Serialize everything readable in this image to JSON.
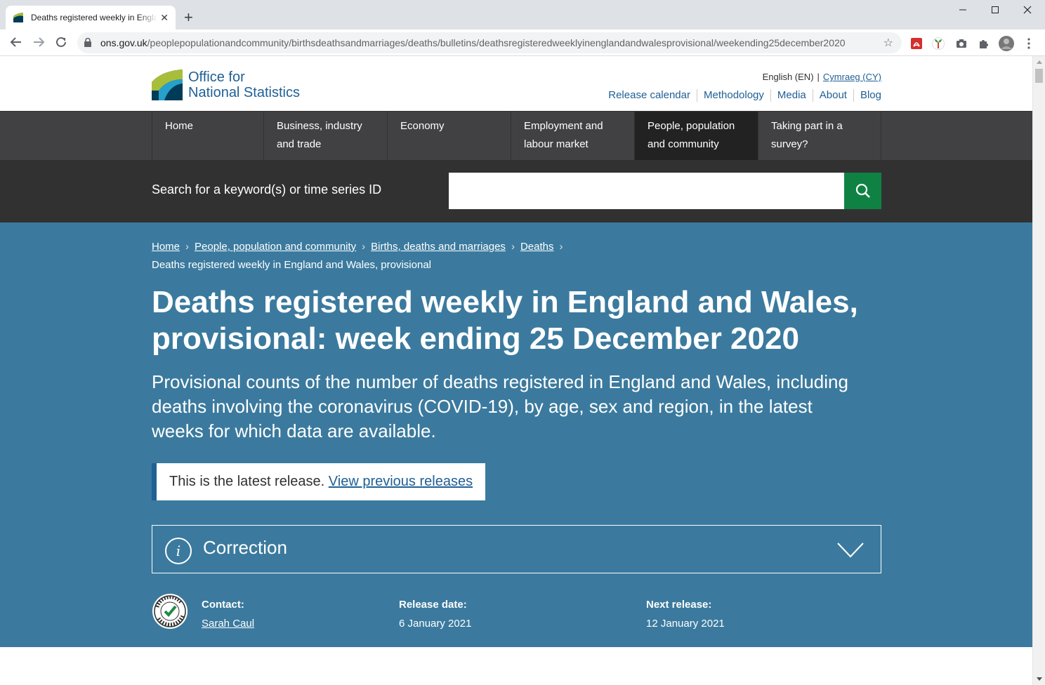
{
  "browser": {
    "tab_title": "Deaths registered weekly in England and Wales",
    "new_tab": "+",
    "url_domain": "ons.gov.uk",
    "url_path": "/peoplepopulationandcommunity/birthsdeathsandmarriages/deaths/bulletins/deathsregisteredweeklyinenglandandwalesprovisional/weekending25december2020"
  },
  "header": {
    "logo_line1": "Office for",
    "logo_line2": "National Statistics",
    "lang_current": "English (EN)",
    "lang_sep": "|",
    "lang_other": "Cymraeg (CY)",
    "links": [
      "Release calendar",
      "Methodology",
      "Media",
      "About",
      "Blog"
    ]
  },
  "nav": {
    "items": [
      {
        "label1": "Home",
        "label2": ""
      },
      {
        "label1": "Business, industry",
        "label2": "and trade"
      },
      {
        "label1": "Economy",
        "label2": ""
      },
      {
        "label1": "Employment and",
        "label2": "labour market"
      },
      {
        "label1": "People, population",
        "label2": "and community"
      },
      {
        "label1": "Taking part in a",
        "label2": "survey?"
      }
    ]
  },
  "search": {
    "label": "Search for a keyword(s) or time series ID",
    "placeholder": ""
  },
  "breadcrumb": {
    "links": [
      "Home",
      "People, population and community",
      "Births, deaths and marriages",
      "Deaths"
    ],
    "current": "Deaths registered weekly in England and Wales, provisional"
  },
  "hero": {
    "title_line1": "Deaths registered weekly in England and Wales,",
    "title_line2": "provisional: week ending 25 December 2020",
    "summary": "Provisional counts of the number of deaths registered in England and Wales, including deaths involving the coronavirus (COVID-19), by age, sex and region, in the latest weeks for which data are available.",
    "latest_text": "This is the latest release.",
    "latest_link": "View previous releases",
    "correction_title": "Correction",
    "info_glyph": "i"
  },
  "meta": {
    "contact_label": "Contact:",
    "contact_value": "Sarah Caul",
    "release_label": "Release date:",
    "release_value": "6 January 2021",
    "next_label": "Next release:",
    "next_value": "12 January 2021"
  },
  "colors": {
    "brand_blue": "#206095",
    "hero_bg": "#3b7a9e",
    "nav_bg": "#414042",
    "search_bg": "#323132",
    "search_button": "#0f8243"
  }
}
